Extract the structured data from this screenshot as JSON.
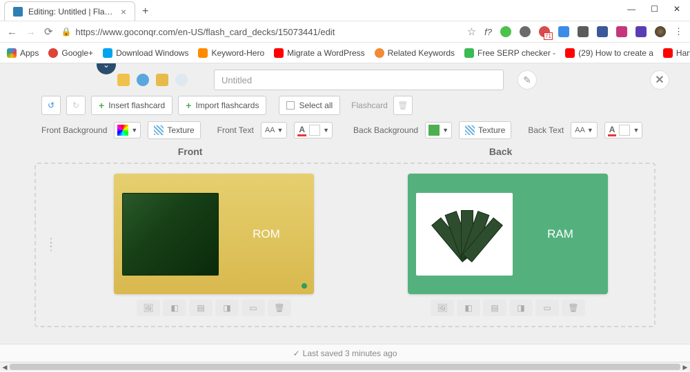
{
  "window": {
    "tab_title": "Editing: Untitled | Flashcards",
    "url": "https://www.goconqr.com/en-US/flash_card_decks/15073441/edit"
  },
  "ext_icons": [
    {
      "glyph": "f?",
      "color": "#333"
    },
    {
      "bg": "#4cc24c"
    },
    {
      "bg": "#6b6b6b"
    },
    {
      "bg": "#d64d4d",
      "badge": "71"
    },
    {
      "bg": "#3d8be8"
    },
    {
      "bg": "#5c5c5c"
    },
    {
      "bg": "#3b5998"
    },
    {
      "bg": "#c7367a"
    },
    {
      "bg": "#5a3db5"
    }
  ],
  "bookmarks": [
    {
      "label": "Apps",
      "color": "#4285f4"
    },
    {
      "label": "Google+",
      "color": "#db4437"
    },
    {
      "label": "Download Windows",
      "color": "#00a4ef"
    },
    {
      "label": "Keyword-Hero",
      "color": "#ff8a00"
    },
    {
      "label": "Migrate a WordPress",
      "color": "#ff0000"
    },
    {
      "label": "Related Keywords",
      "color": "#f28b33"
    },
    {
      "label": "Free SERP checker -",
      "color": "#3cba54"
    },
    {
      "label": "(29) How to create a",
      "color": "#ff0000"
    },
    {
      "label": "Hang Ups (Want You",
      "color": "#ff0000"
    }
  ],
  "deck": {
    "title_placeholder": "Untitled"
  },
  "toolbar": {
    "insert": "Insert flashcard",
    "import": "Import flashcards",
    "select_all": "Select all",
    "flashcard_label": "Flashcard",
    "front_bg": "Front Background",
    "texture": "Texture",
    "front_text": "Front Text",
    "back_bg": "Back Background",
    "back_text": "Back Text",
    "font_sample": "AA"
  },
  "colors": {
    "front_swatch": "#f5d65b",
    "back_swatch": "#4caf50",
    "text_swatch": "#ffffff",
    "underline_red": "#e53935"
  },
  "headers": {
    "front": "Front",
    "back": "Back"
  },
  "cards": {
    "front_text": "ROM",
    "back_text": "RAM"
  },
  "status": {
    "saved": "Last saved 3 minutes ago"
  }
}
